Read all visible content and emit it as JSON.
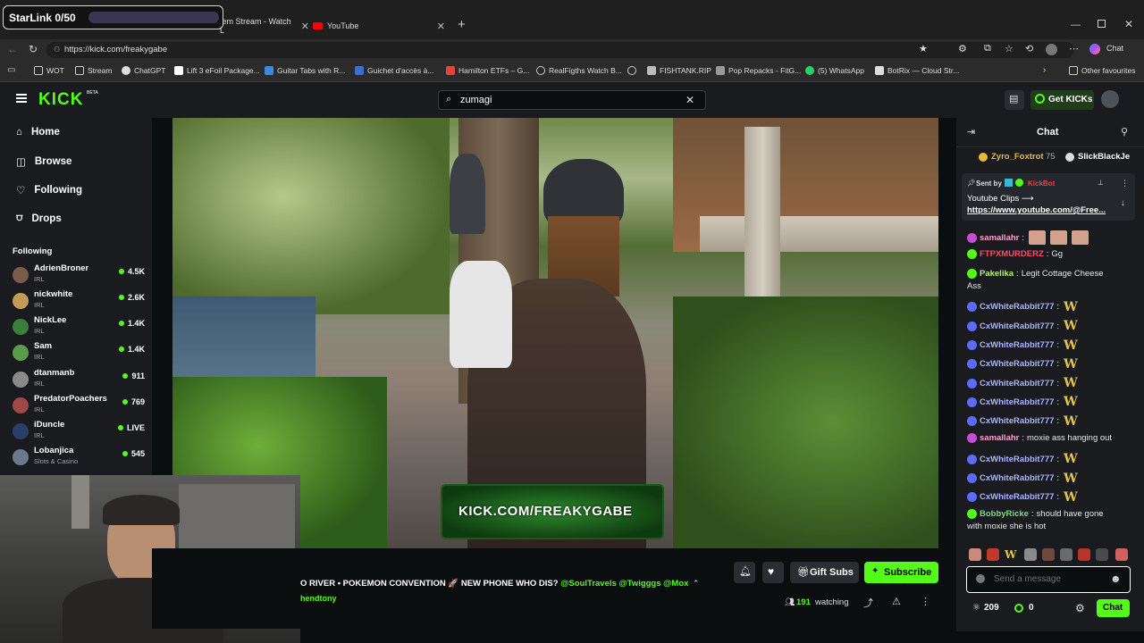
{
  "overlay": {
    "starlink": "StarLink 0/50"
  },
  "browser": {
    "tabs": [
      {
        "label": "tem Stream - Watch L"
      },
      {
        "label": "YouTube"
      }
    ],
    "new_tab": "+",
    "url": "https://kick.com/freakygabe",
    "chat_label": "Chat",
    "bookmarks": [
      "WOT",
      "Stream",
      "ChatGPT",
      "Lift 3 eFoil Package...",
      "Guitar Tabs with R...",
      "Guichet d'accès à...",
      "Hamilton ETFs – G...",
      "RealFigths Watch B...",
      "FISHTANK.RIP",
      "Pop Repacks - FitG...",
      "(5) WhatsApp",
      "BotRix — Cloud Str..."
    ],
    "other_favourites": "Other favourites"
  },
  "kick": {
    "logo": "KICK",
    "logo_badge": "BETA",
    "search_value": "zumagi",
    "get_kicks": "Get KICKs",
    "nav": [
      {
        "label": "Home",
        "icon": "home-icon"
      },
      {
        "label": "Browse",
        "icon": "compass-icon"
      },
      {
        "label": "Following",
        "icon": "heart-icon"
      },
      {
        "label": "Drops",
        "icon": "drops-icon"
      }
    ],
    "following_header": "Following",
    "following": [
      {
        "name": "AdrienBroner",
        "category": "IRL",
        "viewers": "4.5K",
        "color": "#7a5c4a"
      },
      {
        "name": "nickwhite",
        "category": "IRL",
        "viewers": "2.6K",
        "color": "#c29a5a"
      },
      {
        "name": "NickLee",
        "category": "IRL",
        "viewers": "1.4K",
        "color": "#3a7d3c"
      },
      {
        "name": "Sam",
        "category": "IRL",
        "viewers": "1.4K",
        "color": "#5b9c4a"
      },
      {
        "name": "dtanmanb",
        "category": "IRL",
        "viewers": "911",
        "color": "#8a8a8a"
      },
      {
        "name": "PredatorPoachers",
        "category": "IRL",
        "viewers": "769",
        "color": "#a04848"
      },
      {
        "name": "iDuncle",
        "category": "IRL",
        "viewers": "LIVE",
        "color": "#2a3f6a"
      },
      {
        "name": "Lobanjica",
        "category": "Slots & Casino",
        "viewers": "545",
        "color": "#6a7a8a"
      }
    ],
    "watermark": "KICK.COM/FREAKYGABE",
    "stream_title": "O RIVER • POKEMON CONVENTION 🚀 NEW PHONE WHO DIS? ",
    "stream_mentions": "@SoulTravels @Twigggs @Mox",
    "stream_sub": "hendtony",
    "gift_subs": "Gift Subs",
    "subscribe": "Subscribe",
    "watching_count": "191",
    "watching_label": "watching"
  },
  "chat": {
    "header": "Chat",
    "leaderboard": [
      {
        "name": "Zyro_Foxtrot",
        "count": "75"
      },
      {
        "name": "SlickBlackJe"
      }
    ],
    "pinned": {
      "sent_by": "Sent by",
      "bot": "KickBot",
      "title": "Youtube Clips ⟶",
      "link": "https://www.youtube.com/@Free..."
    },
    "messages": [
      {
        "user": "samallahr",
        "color": "#ff9fd0",
        "text": "",
        "emote": "faces"
      },
      {
        "user": "FTPXMURDERZ",
        "color": "#ff4a6a",
        "text": "Gg"
      },
      {
        "user": "Pakelika",
        "color": "#b8f07a",
        "text": "Legit Cottage Cheese",
        "cont": "Ass"
      },
      {
        "user": "CxWhiteRabbit777",
        "color": "#a9b4ff",
        "text": "",
        "emote": "W"
      },
      {
        "user": "CxWhiteRabbit777",
        "color": "#a9b4ff",
        "text": "",
        "emote": "W"
      },
      {
        "user": "CxWhiteRabbit777",
        "color": "#a9b4ff",
        "text": "",
        "emote": "W"
      },
      {
        "user": "CxWhiteRabbit777",
        "color": "#a9b4ff",
        "text": "",
        "emote": "W"
      },
      {
        "user": "CxWhiteRabbit777",
        "color": "#a9b4ff",
        "text": "",
        "emote": "W"
      },
      {
        "user": "CxWhiteRabbit777",
        "color": "#a9b4ff",
        "text": "",
        "emote": "W"
      },
      {
        "user": "CxWhiteRabbit777",
        "color": "#a9b4ff",
        "text": "",
        "emote": "W"
      },
      {
        "user": "samallahr",
        "color": "#ff9fd0",
        "text": "moxie ass hanging out"
      },
      {
        "user": "CxWhiteRabbit777",
        "color": "#a9b4ff",
        "text": "",
        "emote": "W"
      },
      {
        "user": "CxWhiteRabbit777",
        "color": "#a9b4ff",
        "text": "",
        "emote": "W"
      },
      {
        "user": "CxWhiteRabbit777",
        "color": "#a9b4ff",
        "text": "",
        "emote": "W"
      },
      {
        "user": "BobbyRicke",
        "color": "#6ae07a",
        "text": "should have gone",
        "cont": "with moxie she is hot"
      }
    ],
    "input_placeholder": "Send a message",
    "points": "209",
    "kicks": "0",
    "send": "Chat"
  },
  "colors": {
    "kick_green": "#53fc18",
    "bg": "#0b0e0f",
    "panel": "#191b1f"
  }
}
